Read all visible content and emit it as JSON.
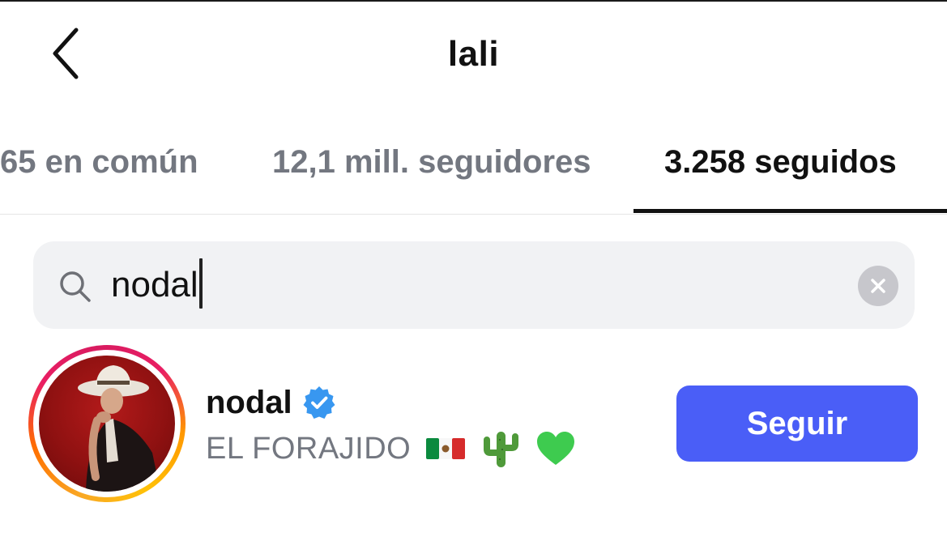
{
  "header": {
    "title": "lali",
    "back_icon": "chevron-left-icon"
  },
  "tabs": [
    {
      "label": "65 en común",
      "active": false
    },
    {
      "label": "12,1 mill. seguidores",
      "active": false
    },
    {
      "label": "3.258 seguidos",
      "active": true
    }
  ],
  "search": {
    "value": "nodal",
    "icon": "search-icon",
    "clear_icon": "clear-icon"
  },
  "results": [
    {
      "username": "nodal",
      "verified": true,
      "bio": "EL FORAJIDO",
      "bio_emojis": [
        "mexico-flag-icon",
        "cactus-icon",
        "green-heart-icon"
      ],
      "follow_label": "Seguir",
      "has_story_ring": true
    }
  ],
  "colors": {
    "follow_button": "#4a5ef7",
    "verified_badge": "#3897f0",
    "muted_text": "#737780",
    "search_bg": "#f1f2f4"
  }
}
